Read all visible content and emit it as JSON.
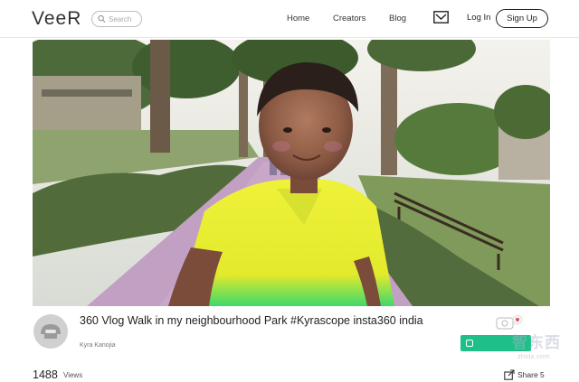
{
  "header": {
    "logo": "VeeR",
    "search_placeholder": "Search",
    "nav": [
      "Home",
      "Creators",
      "Blog"
    ],
    "login": "Log In",
    "signup": "Sign Up"
  },
  "video": {
    "title": "360 Vlog Walk in my neighbourhood Park #Kyrascope insta360 india",
    "author": "Kyra Kanojia",
    "views_count": "1488",
    "views_label": "Views",
    "share_label": "Share 5"
  },
  "watermark": {
    "text": "智东西",
    "sub": "zhidx.com"
  },
  "colors": {
    "accent_green": "#1fbf8a",
    "border": "#e6e6e6"
  }
}
